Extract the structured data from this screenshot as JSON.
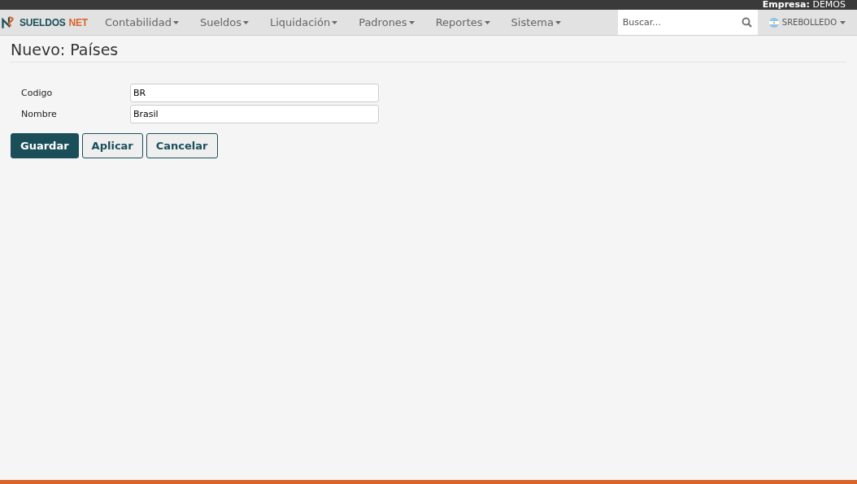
{
  "top_bar": {
    "company_label": "Empresa:",
    "company_value": "DEMOS"
  },
  "logo": {
    "part_1": "SUELDOS",
    "part_2": "NET"
  },
  "menu": [
    {
      "label": "Contabilidad"
    },
    {
      "label": "Sueldos"
    },
    {
      "label": "Liquidación"
    },
    {
      "label": "Padrones"
    },
    {
      "label": "Reportes"
    },
    {
      "label": "Sistema"
    }
  ],
  "search": {
    "placeholder": "Buscar..."
  },
  "user": {
    "name": "SREBOLLEDO"
  },
  "page_title": "Nuevo: Países",
  "fields": [
    {
      "label": "Codigo",
      "value": "BR"
    },
    {
      "label": "Nombre",
      "value": "Brasil"
    }
  ],
  "buttons": [
    {
      "label": "Guardar",
      "kind": "primary"
    },
    {
      "label": "Aplicar",
      "kind": "default"
    },
    {
      "label": "Cancelar",
      "kind": "default"
    }
  ]
}
